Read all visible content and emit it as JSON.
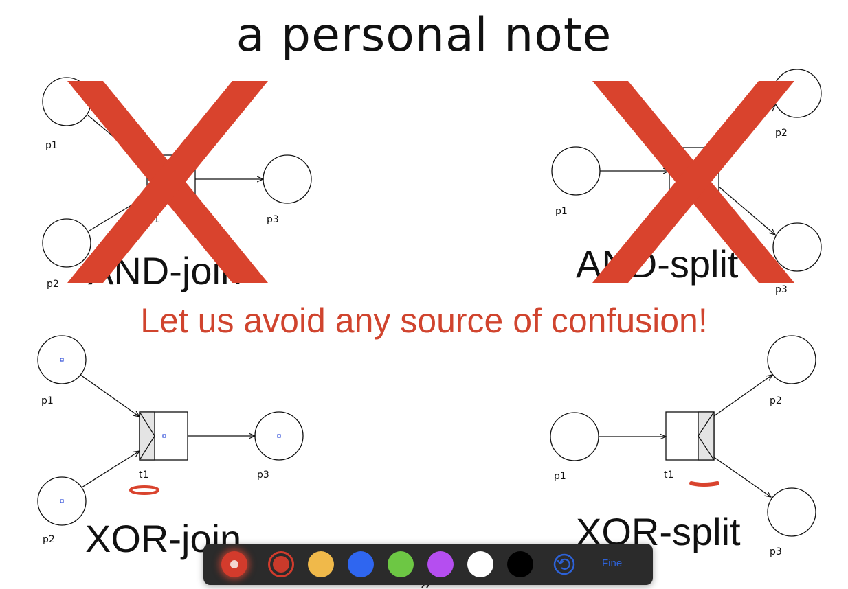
{
  "slide": {
    "title": "a personal note",
    "warning": "Let us avoid any source of confusion!",
    "diagrams": {
      "and_join": {
        "label": "AND-join",
        "places": [
          "p1",
          "p2",
          "p3"
        ],
        "transition": "t1",
        "crossed_out": true
      },
      "and_split": {
        "label": "AND-split",
        "places": [
          "p1",
          "p2",
          "p3"
        ],
        "crossed_out": true
      },
      "xor_join": {
        "label": "XOR-join",
        "places": [
          "p1",
          "p2",
          "p3"
        ],
        "transition": "t1"
      },
      "xor_split": {
        "label": "XOR-split",
        "places": [
          "p1",
          "p2",
          "p3"
        ],
        "transition": "t1"
      }
    }
  },
  "toolbar": {
    "done_label": "Fine",
    "colors": [
      {
        "name": "red-selected",
        "hex": "#c93a2b"
      },
      {
        "name": "yellow",
        "hex": "#f0b94a"
      },
      {
        "name": "blue",
        "hex": "#2f66f0"
      },
      {
        "name": "green",
        "hex": "#6dc744"
      },
      {
        "name": "purple",
        "hex": "#b54ef0"
      },
      {
        "name": "white",
        "hex": "#ffffff"
      },
      {
        "name": "black",
        "hex": "#000000"
      }
    ],
    "icons": {
      "pen": "pen-tool-icon",
      "undo": "undo-icon"
    }
  },
  "colors": {
    "annotation_red": "#d0442e",
    "toolbar_bg": "#2b2b2b",
    "accent_blue": "#2d62d8"
  }
}
